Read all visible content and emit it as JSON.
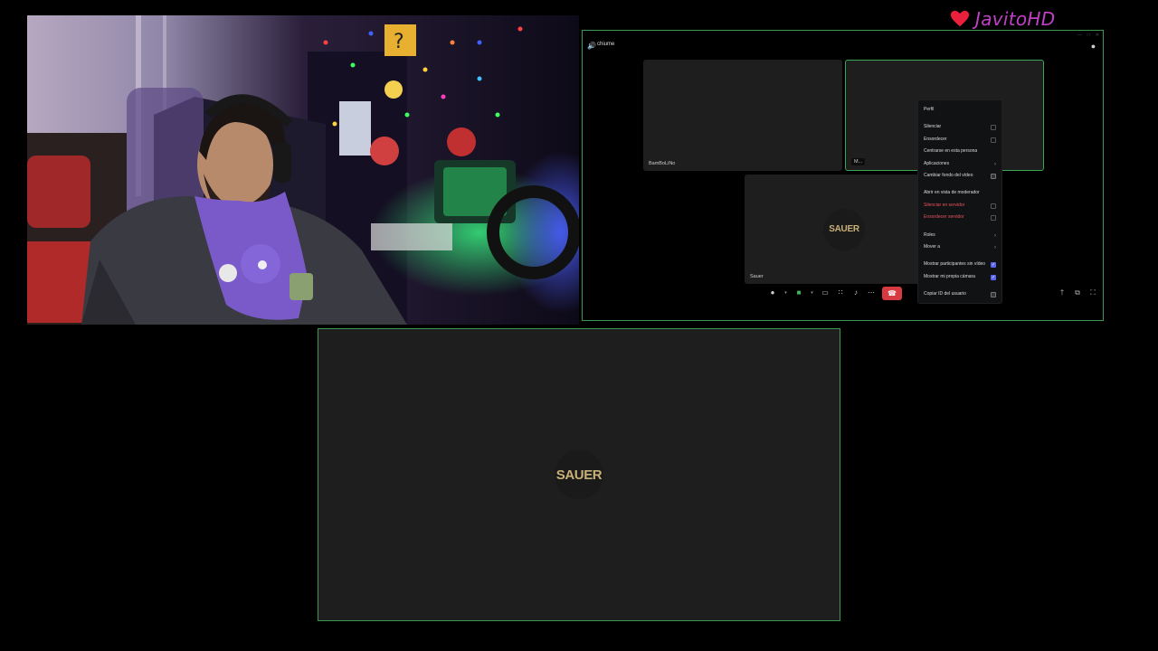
{
  "branding": {
    "name": "JavitoHD",
    "heart_color": "#e8203c",
    "name_color": "#c040c8"
  },
  "call": {
    "channel_name": "chiume",
    "participants": [
      {
        "name": "BamBoLiNo"
      },
      {
        "name": "M..."
      },
      {
        "name": "Sauer",
        "avatar_text": "SAUER"
      }
    ],
    "accent": "#3dbb5c",
    "hangup_color": "#d83a42"
  },
  "context_menu": {
    "items": [
      {
        "label": "Perfil"
      },
      {
        "label": "Silenciar",
        "control": "checkbox",
        "checked": false
      },
      {
        "label": "Ensordecer",
        "control": "checkbox",
        "checked": false
      },
      {
        "label": "Centrarse en esta persona"
      },
      {
        "label": "Aplicaciones",
        "control": "submenu"
      },
      {
        "label": "Cambiar fondo del vídeo",
        "control": "icon"
      },
      {
        "label": "Abrir en vista de moderador"
      },
      {
        "label": "Silenciar en servidor",
        "control": "checkbox",
        "checked": false,
        "danger": true
      },
      {
        "label": "Ensordecer servidor",
        "control": "checkbox",
        "checked": false,
        "danger": true
      },
      {
        "label": "Roles",
        "control": "submenu"
      },
      {
        "label": "Mover a",
        "control": "submenu"
      },
      {
        "label": "Mostrar participantes sin vídeo",
        "control": "checkbox",
        "checked": true
      },
      {
        "label": "Mostrar mi propia cámara",
        "control": "checkbox",
        "checked": true
      },
      {
        "label": "Copiar ID del usuario",
        "control": "icon"
      }
    ]
  },
  "focus": {
    "avatar_text": "SAUER"
  }
}
